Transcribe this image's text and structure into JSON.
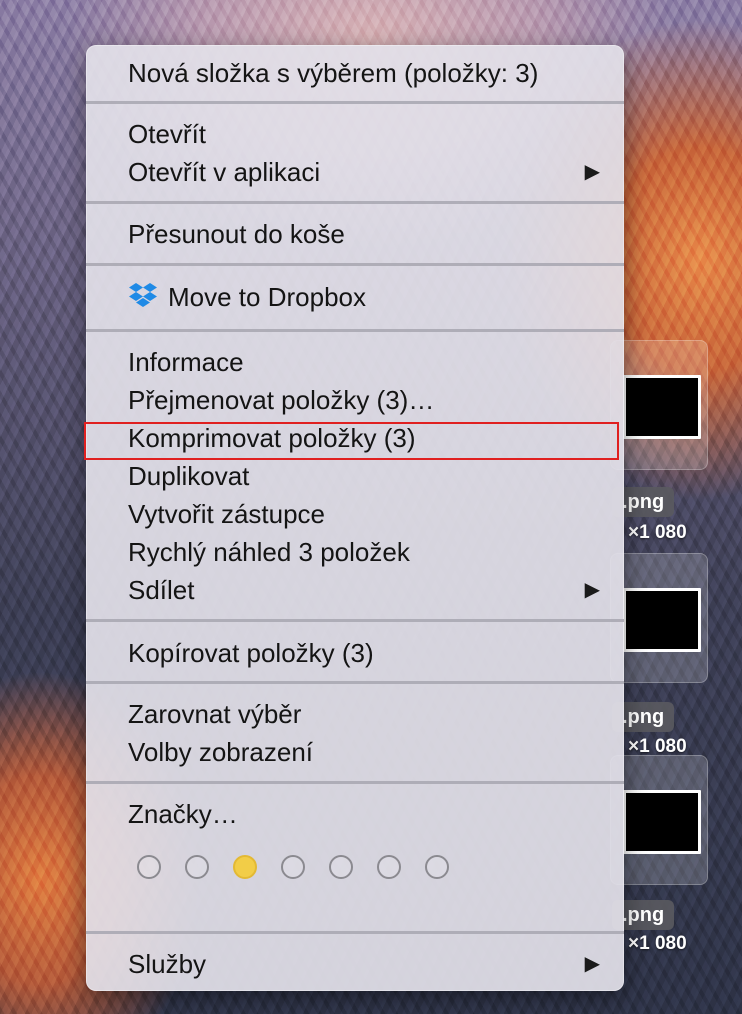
{
  "desktop": {
    "files": [
      {
        "name": ".png",
        "dims": "×1 080"
      },
      {
        "name": ".png",
        "dims": "×1 080"
      },
      {
        "name": ".png",
        "dims": "×1 080"
      }
    ]
  },
  "menu": {
    "new_folder": "Nová složka s výběrem (položky: 3)",
    "open": "Otevřít",
    "open_with": "Otevřít v aplikaci",
    "move_to_trash": "Přesunout do koše",
    "move_to_dropbox": "Move to Dropbox",
    "get_info": "Informace",
    "rename": "Přejmenovat položky (3)…",
    "compress": "Komprimovat položky (3)",
    "duplicate": "Duplikovat",
    "make_alias": "Vytvořit zástupce",
    "quick_look": "Rychlý náhled 3 položek",
    "share": "Sdílet",
    "copy": "Kopírovat položky (3)",
    "clean_up": "Zarovnat výběr",
    "view_options": "Volby zobrazení",
    "tags": "Značky…",
    "services": "Služby",
    "submenu_arrow": "▶",
    "tag_colors": [
      "none",
      "none",
      "yellow",
      "none",
      "none",
      "none",
      "none"
    ],
    "colors": {
      "yellow_tag": "#f2cd47",
      "highlight": "#e02020"
    }
  }
}
